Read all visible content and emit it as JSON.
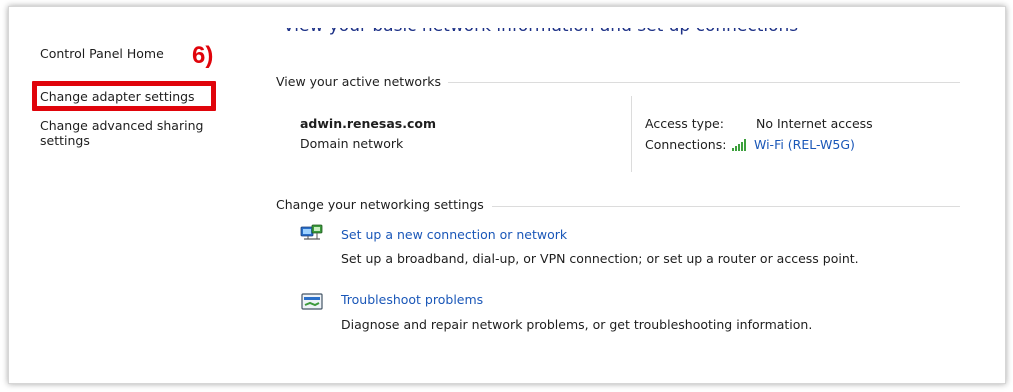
{
  "annotation": {
    "step_label": "6)",
    "highlight_color": "#e0040b"
  },
  "sidebar": {
    "items": [
      {
        "label": "Control Panel Home"
      },
      {
        "label": "Change adapter settings"
      },
      {
        "label": "Change advanced sharing settings"
      }
    ]
  },
  "header": {
    "title": "View your basic network information and set up connections"
  },
  "active_networks": {
    "section_title": "View your active networks",
    "network_name": "adwin.renesas.com",
    "network_type": "Domain network",
    "access_type_label": "Access type:",
    "access_type_value": "No Internet access",
    "connections_label": "Connections:",
    "connections_value": "Wi-Fi (REL-W5G)",
    "signal_icon": "wifi-signal-icon"
  },
  "networking_settings": {
    "section_title": "Change your networking settings",
    "tasks": [
      {
        "title": "Set up a new connection or network",
        "description": "Set up a broadband, dial-up, or VPN connection; or set up a router or access point.",
        "icon": "new-connection-icon"
      },
      {
        "title": "Troubleshoot problems",
        "description": "Diagnose and repair network problems, or get troubleshooting information.",
        "icon": "troubleshoot-icon"
      }
    ]
  },
  "colors": {
    "link": "#1a57b8",
    "heading": "#1e3287",
    "signal": "#3ca03c"
  }
}
